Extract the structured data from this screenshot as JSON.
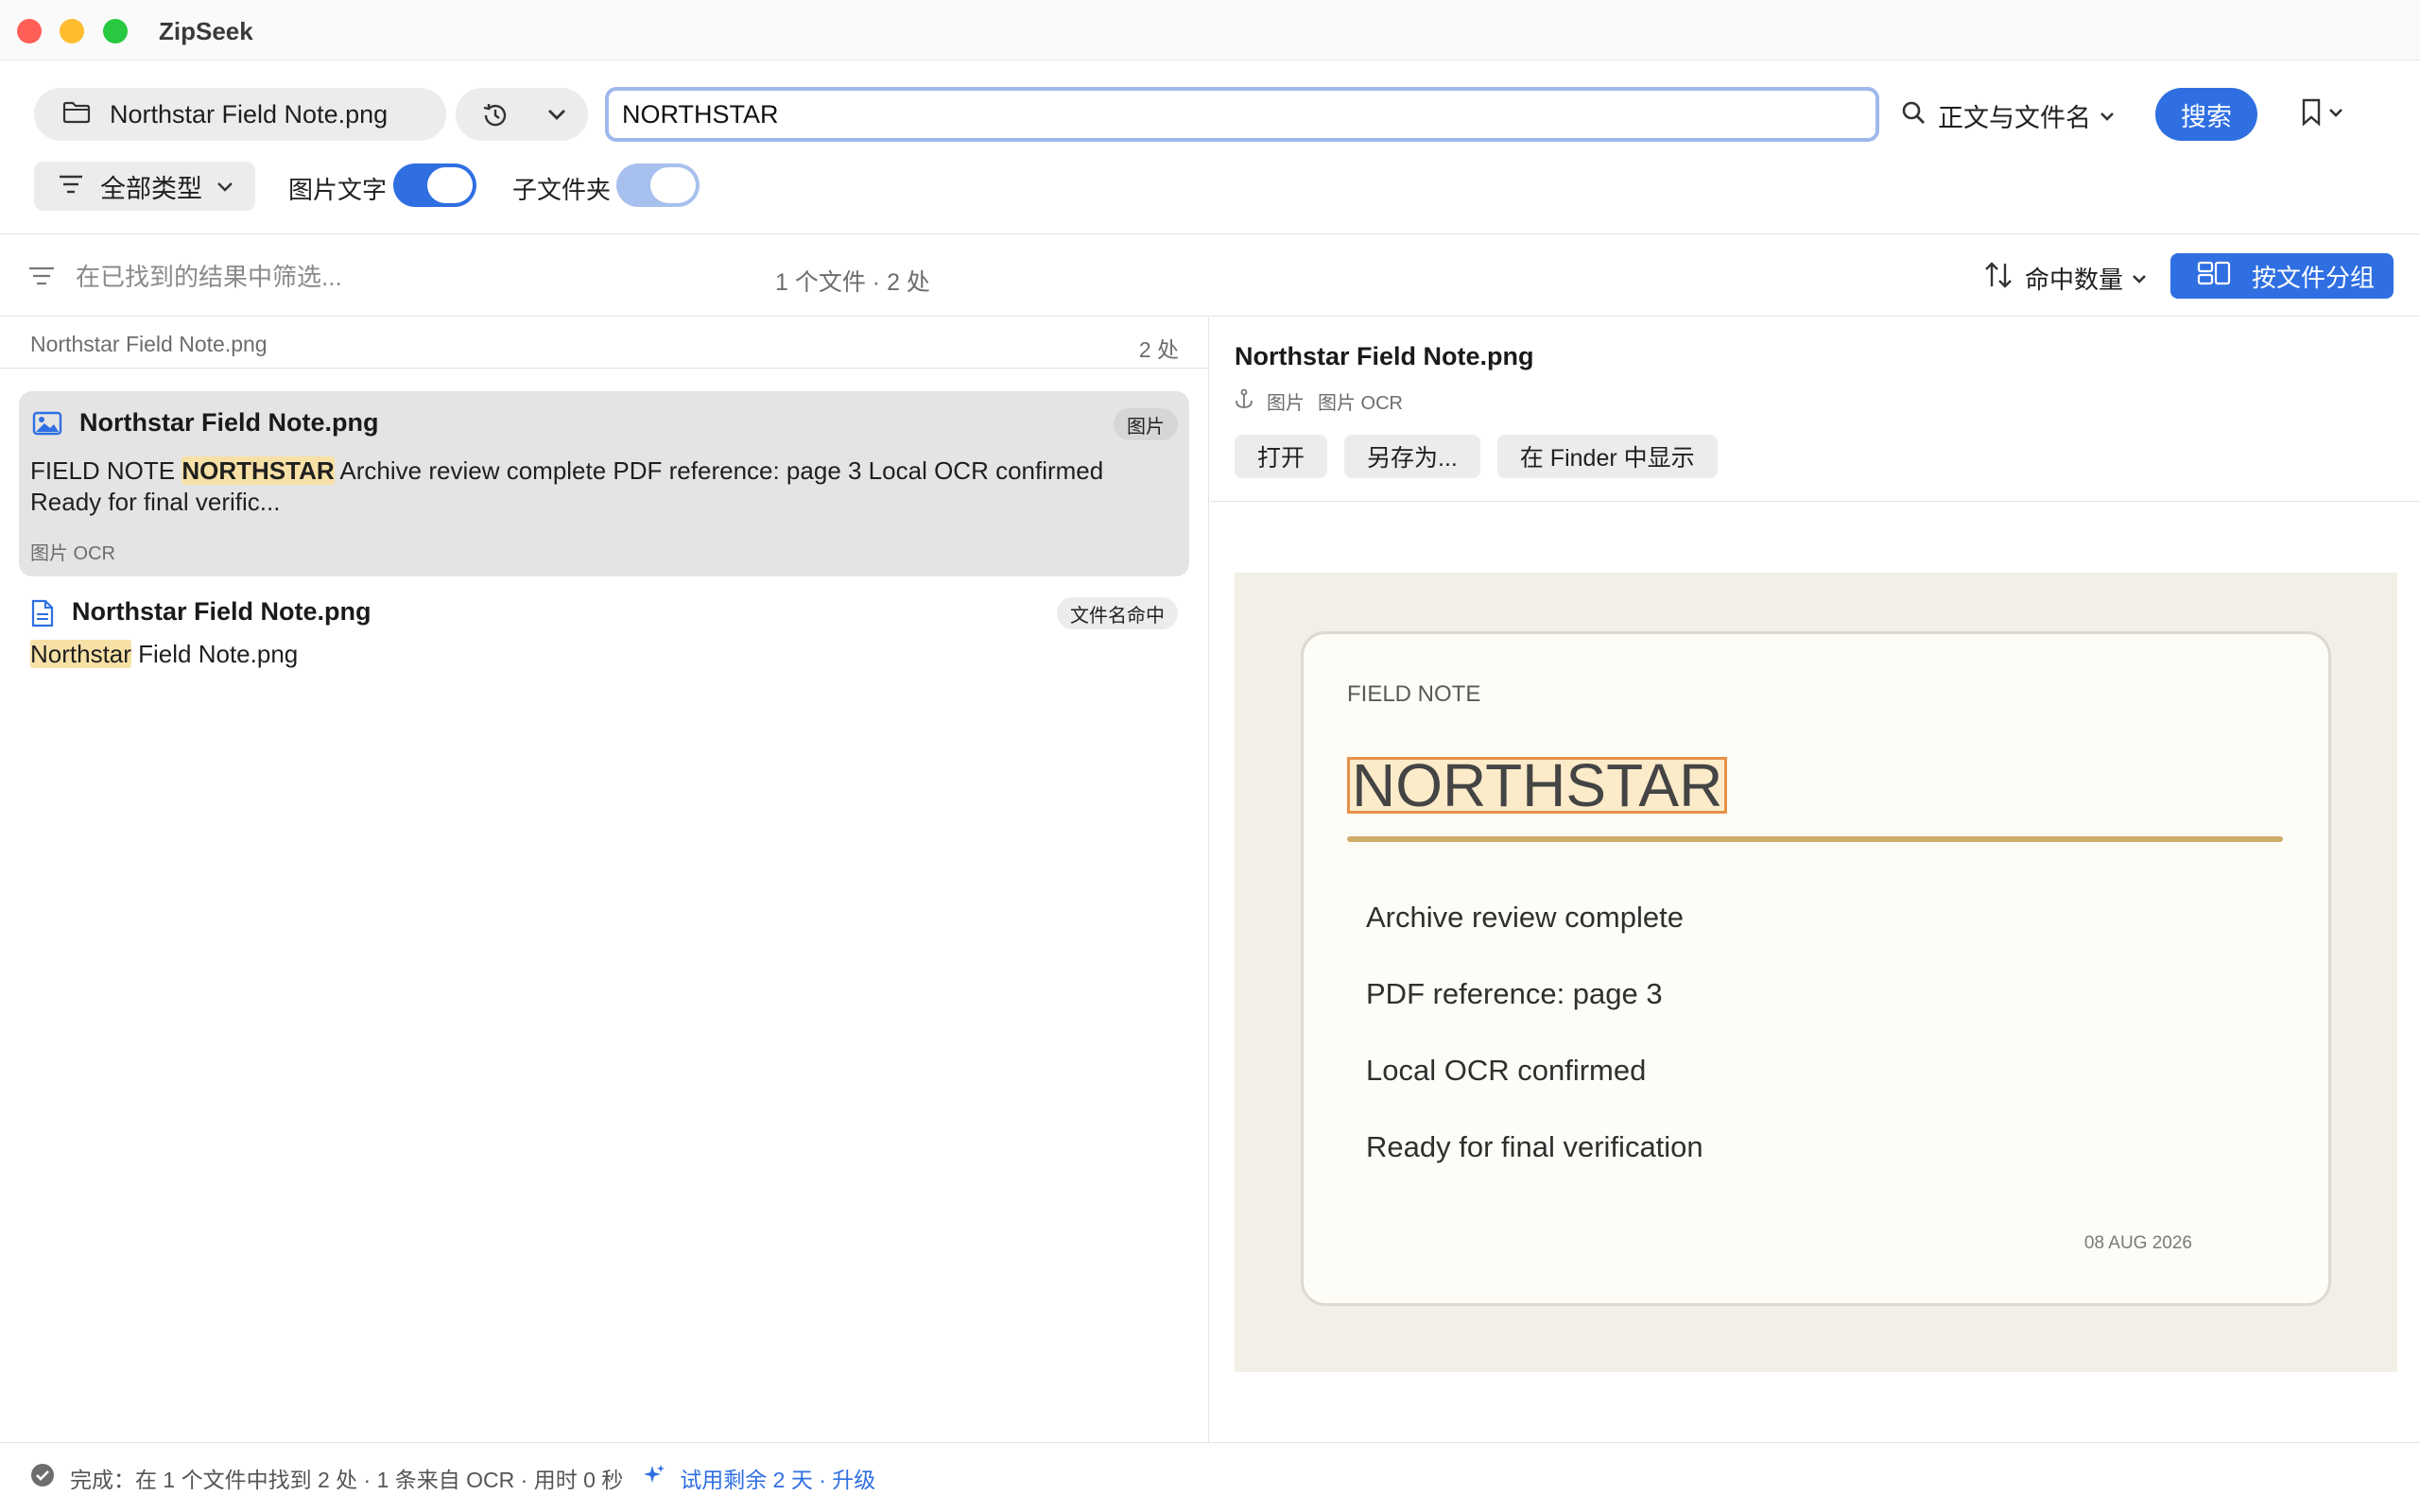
{
  "app": {
    "title": "ZipSeek"
  },
  "toolbar": {
    "folder_label": "Northstar Field Note.png",
    "search_value": "NORTHSTAR",
    "scope_label": "正文与文件名",
    "search_button": "搜索",
    "type_filter": "全部类型",
    "image_text_label": "图片文字",
    "image_text_on": true,
    "subfolder_label": "子文件夹",
    "subfolder_on": true
  },
  "filterbar": {
    "placeholder": "在已找到的结果中筛选...",
    "summary": "1 个文件 · 2 处",
    "sort_label": "命中数量",
    "group_button": "按文件分组"
  },
  "results": {
    "file_name": "Northstar Field Note.png",
    "file_count": "2 处",
    "items": [
      {
        "title": "Northstar Field Note.png",
        "badge": "图片",
        "snippet_pre": "FIELD NOTE ",
        "snippet_hit": "NORTHSTAR",
        "snippet_post": " Archive review complete PDF reference: page 3 Local OCR confirmed Ready for final verific...",
        "meta": "图片 OCR",
        "selected": true,
        "icon": "image-icon"
      },
      {
        "title": "Northstar Field Note.png",
        "badge": "文件名命中",
        "snippet_hit": "Northstar",
        "snippet_post": " Field Note.png",
        "selected": false,
        "icon": "document-icon"
      }
    ]
  },
  "preview": {
    "title": "Northstar Field Note.png",
    "meta_type": "图片",
    "meta_source": "图片 OCR",
    "actions": {
      "open": "打开",
      "save_as": "另存为...",
      "reveal": "在 Finder 中显示"
    },
    "card": {
      "label": "FIELD NOTE",
      "headline": "NORTHSTAR",
      "lines": [
        "Archive review complete",
        "PDF reference: page 3",
        "Local OCR confirmed",
        "Ready for final verification"
      ],
      "date": "08 AUG 2026"
    }
  },
  "status": {
    "text": "完成：在 1 个文件中找到 2 处 · 1 条来自 OCR · 用时 0 秒",
    "trial": "试用剩余 2 天 · 升级"
  },
  "colors": {
    "accent": "#2f6fe2",
    "highlight": "#f8e1a6",
    "ocr_box": "#e6914a",
    "card_rule": "#cfac6a"
  }
}
